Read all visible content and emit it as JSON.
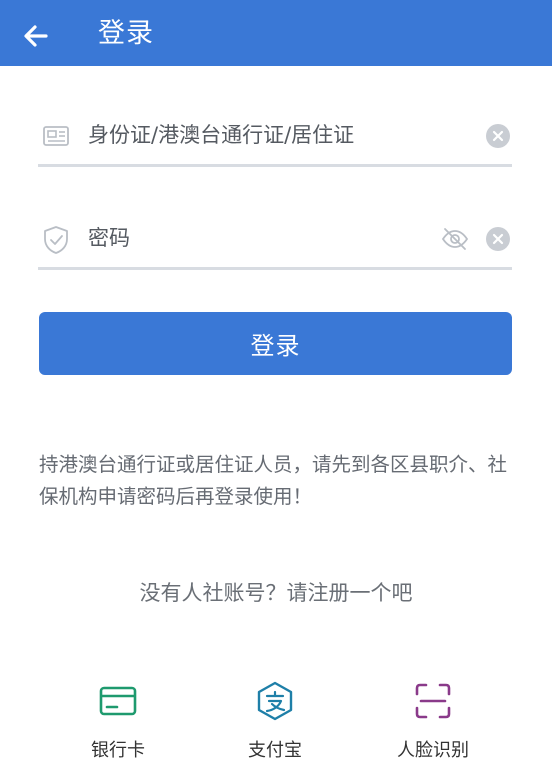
{
  "header": {
    "title": "登录",
    "back_icon": "arrow-left-icon"
  },
  "form": {
    "id_field": {
      "placeholder": "身份证/港澳台通行证/居住证",
      "value": "",
      "icon": "id-card-icon"
    },
    "password_field": {
      "placeholder": "密码",
      "value": "",
      "icon": "shield-check-icon",
      "visibility_icon": "eye-off-icon"
    },
    "login_label": "登录"
  },
  "notice": "持港澳台通行证或居住证人员，请先到各区县职介、社保机构申请密码后再登录使用！",
  "register_link": "没有人社账号？请注册一个吧",
  "alt_logins": [
    {
      "label": "银行卡",
      "icon": "bank-card-icon",
      "color": "#1e9a6e"
    },
    {
      "label": "支付宝",
      "icon": "alipay-icon",
      "color": "#1e7fa8"
    },
    {
      "label": "人脸识别",
      "icon": "face-scan-icon",
      "color": "#8a3a8a"
    }
  ],
  "colors": {
    "primary": "#3a78d6",
    "divider": "#d8dce2"
  }
}
